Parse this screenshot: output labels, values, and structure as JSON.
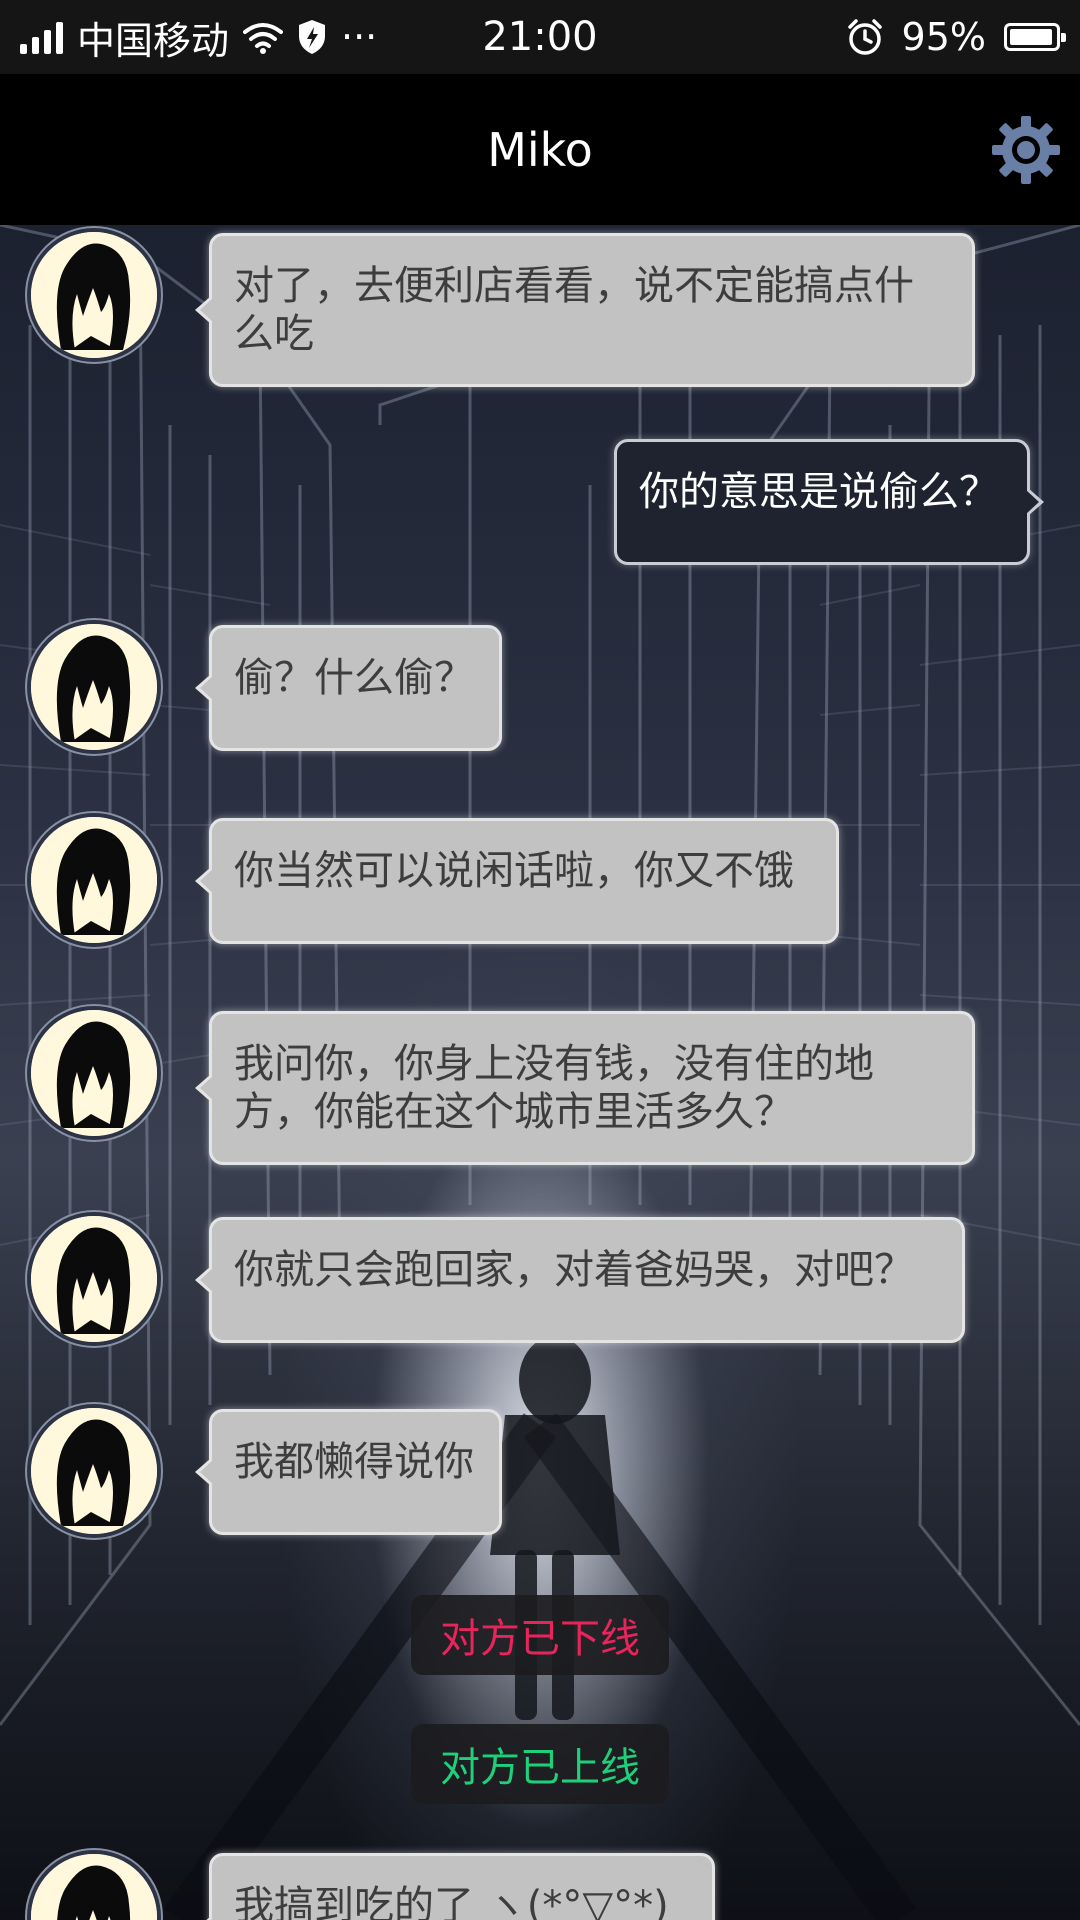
{
  "status_bar": {
    "carrier": "中国移动",
    "time": "21:00",
    "battery_percent": "95%",
    "battery_level": 0.95,
    "more": "···"
  },
  "header": {
    "title": "Miko",
    "settings_icon": "gear-icon"
  },
  "colors": {
    "offline": "#e8245c",
    "online": "#1ed07a",
    "incoming_bubble": "#c2c2c2",
    "outgoing_bubble": "#1f2330",
    "settings_gear": "#6a7fa6"
  },
  "messages": [
    {
      "side": "left",
      "text": "对了，去便利店看看，说不定能搞点什么吃"
    },
    {
      "side": "right",
      "text": "你的意思是说偷么？"
    },
    {
      "side": "left",
      "text": "偷？什么偷？"
    },
    {
      "side": "left",
      "text": "你当然可以说闲话啦，你又不饿"
    },
    {
      "side": "left",
      "text": "我问你，你身上没有钱，没有住的地方，你能在这个城市里活多久？"
    },
    {
      "side": "left",
      "text": "你就只会跑回家，对着爸妈哭，对吧？"
    },
    {
      "side": "left",
      "text": "我都懒得说你"
    },
    {
      "side": "system",
      "text": "对方已下线",
      "status": "offline"
    },
    {
      "side": "system",
      "text": "对方已上线",
      "status": "online"
    },
    {
      "side": "left",
      "text": "我搞到吃的了 ヽ(*°▽°*)ノ"
    }
  ]
}
